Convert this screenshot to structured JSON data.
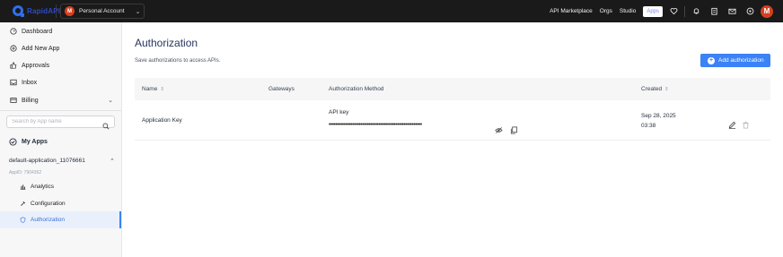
{
  "topbar": {
    "logo_text": "RapidAPI",
    "account_initial": "M",
    "account_label": "Personal Account",
    "nav": [
      "API Marketplace",
      "Orgs",
      "Studio"
    ],
    "apps_label": "Apps",
    "user_initial": "M"
  },
  "sidebar": {
    "items": [
      {
        "label": "Dashboard",
        "icon": "gauge-icon"
      },
      {
        "label": "Add New App",
        "icon": "plus-circle-icon"
      },
      {
        "label": "Approvals",
        "icon": "thumbs-up-icon"
      },
      {
        "label": "Inbox",
        "icon": "inbox-icon"
      },
      {
        "label": "Billing",
        "icon": "card-icon"
      }
    ],
    "search_placeholder": "Search by App name",
    "my_apps_label": "My Apps",
    "app_name": "default-application_11076661",
    "app_id": "AppID: 7904362",
    "sub_items": [
      {
        "label": "Analytics",
        "icon": "bar-chart-icon"
      },
      {
        "label": "Configuration",
        "icon": "wrench-icon"
      },
      {
        "label": "Authorization",
        "icon": "shield-icon",
        "active": true
      }
    ]
  },
  "main": {
    "title": "Authorization",
    "subtitle": "Save authorizations to access APIs.",
    "add_button_label": "Add authorization",
    "table": {
      "headers": {
        "name": "Name",
        "gateways": "Gateways",
        "method": "Authorization Method",
        "created": "Created"
      },
      "rows": [
        {
          "name": "Application Key",
          "gateways": "",
          "method_label": "API key",
          "masked_value": "••••••••••••••••••••••••••••••••••••••••••••••••••••••••",
          "created_date": "Sep 28, 2025",
          "created_time": "03:38"
        }
      ]
    }
  },
  "colors": {
    "accent": "#3b82f6",
    "topbar_bg": "#1a1a1a",
    "avatar": "#d6401f",
    "active_bg": "#e9f0fb"
  }
}
